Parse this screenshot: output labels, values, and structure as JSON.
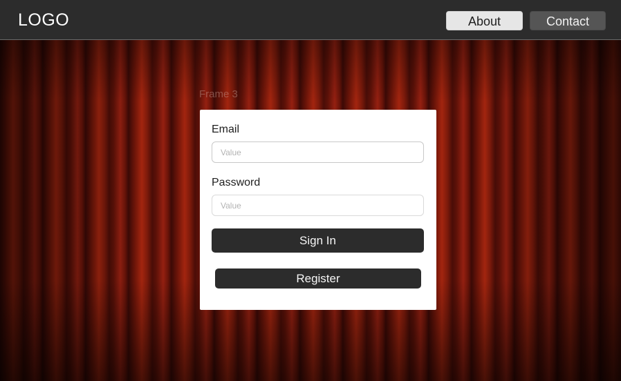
{
  "header": {
    "logo": "LOGO",
    "nav": {
      "about_label": "About",
      "contact_label": "Contact"
    }
  },
  "frame": {
    "label": "Frame 3"
  },
  "form": {
    "email": {
      "label": "Email",
      "placeholder": "Value",
      "value": ""
    },
    "password": {
      "label": "Password",
      "placeholder": "Value",
      "value": ""
    },
    "signin_label": "Sign In",
    "register_label": "Register"
  },
  "colors": {
    "navbar": "#2c2c2c",
    "button_dark": "#2c2c2c",
    "about_button": "#e6e6e6",
    "contact_button": "#555555",
    "curtain": "#952011"
  }
}
